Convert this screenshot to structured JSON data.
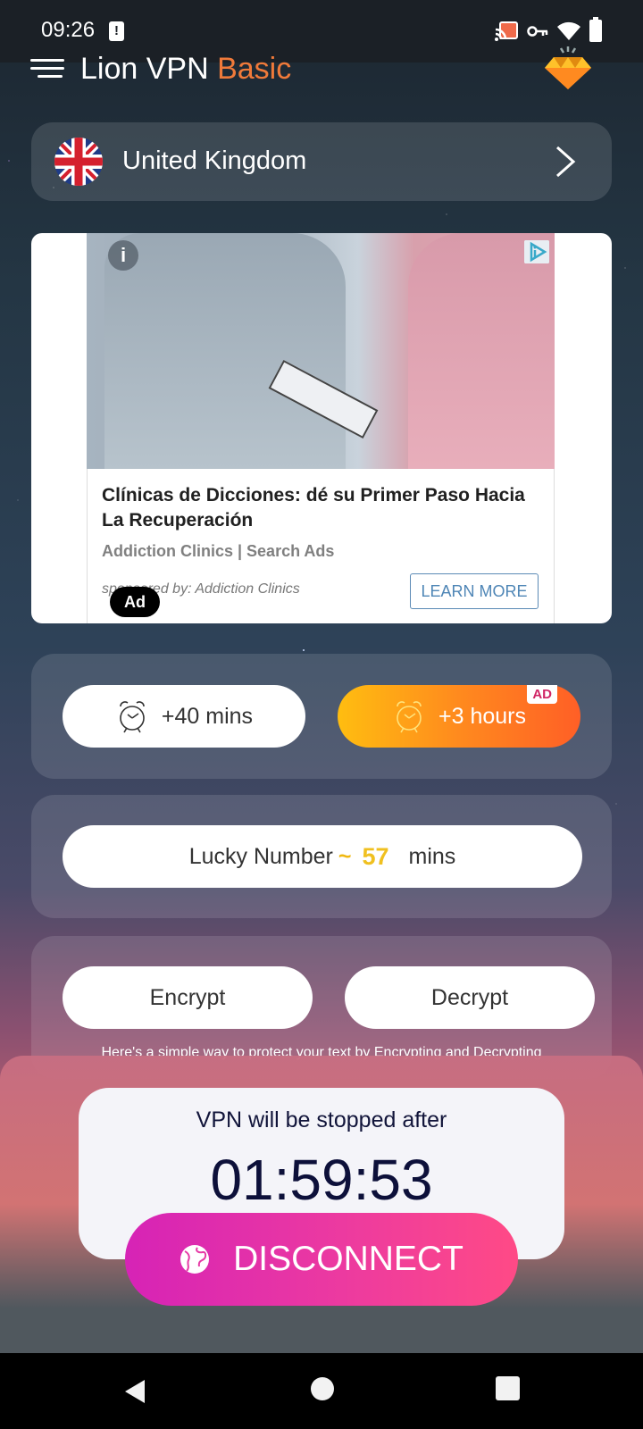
{
  "status_bar": {
    "time": "09:26",
    "alert_glyph": "!",
    "icons": [
      "cast-icon",
      "vpn-key-icon",
      "wifi-icon",
      "battery-icon"
    ]
  },
  "header": {
    "title": "Lion VPN",
    "title_accent": "Basic",
    "accent_color": "#f07a3a",
    "menu_icon": "hamburger-menu-icon",
    "premium_icon": "diamond-icon"
  },
  "location": {
    "country": "United Kingdom",
    "flag": "uk-flag-icon"
  },
  "ad": {
    "info_glyph": "i",
    "headline": "Clínicas de Dicciones: dé su Primer Paso Hacia La Recuperación",
    "advertiser": "Addiction Clinics | Search Ads",
    "sponsor": "sponsored by: Addiction Clinics",
    "badge": "Ad",
    "cta": "LEARN MORE"
  },
  "time_extend": {
    "free_button": "+40 mins",
    "ad_button": "+3 hours",
    "ad_tag": "AD"
  },
  "lucky": {
    "label": "Lucky Number",
    "tilde": "~",
    "number": "57",
    "unit": "mins",
    "number_color": "#f0c020"
  },
  "crypto": {
    "encrypt": "Encrypt",
    "decrypt": "Decrypt",
    "note": "Here's a simple way to protect your text by Encrypting and Decrypting"
  },
  "timer": {
    "label": "VPN will be stopped after",
    "value": "01:59:53"
  },
  "disconnect": {
    "label": "DISCONNECT"
  }
}
